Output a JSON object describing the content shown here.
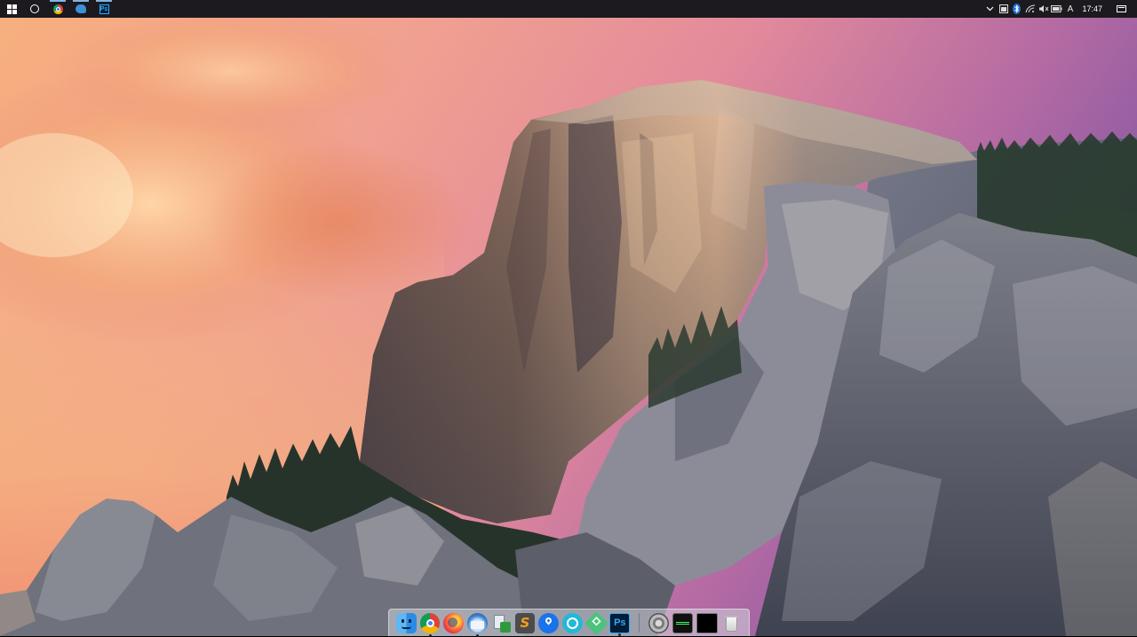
{
  "taskbar": {
    "left_items": [
      {
        "name": "start-button",
        "icon": "windows-logo-icon"
      },
      {
        "name": "cortana-search-button",
        "icon": "circle-icon"
      },
      {
        "name": "chrome-taskbar-button",
        "icon": "chrome-icon"
      },
      {
        "name": "thunderbird-taskbar-button",
        "icon": "thunderbird-icon"
      },
      {
        "name": "photoshop-taskbar-button",
        "icon": "photoshop-icon",
        "label": "Ps"
      }
    ],
    "tray_icons": [
      "chevron-up-icon",
      "taskbar-app-icon",
      "bluetooth-icon",
      "wifi-icon",
      "mute-speaker-icon",
      "battery-icon",
      "input-language-icon"
    ],
    "language_indicator": "A",
    "clock": "17:47",
    "notification_icon": "action-center-icon"
  },
  "dock": {
    "apps": [
      {
        "name": "finder",
        "icon": "finder-icon",
        "running": false
      },
      {
        "name": "chrome",
        "icon": "chrome-icon",
        "running": true
      },
      {
        "name": "firefox",
        "icon": "firefox-icon",
        "running": false
      },
      {
        "name": "thunderbird",
        "icon": "thunderbird-icon",
        "running": true
      },
      {
        "name": "preview",
        "icon": "preview-icon",
        "running": false
      },
      {
        "name": "sublime-text",
        "icon": "sublime-text-icon",
        "running": false
      },
      {
        "name": "maps",
        "icon": "maps-pin-icon",
        "running": false
      },
      {
        "name": "circle-app",
        "icon": "circle-app-icon",
        "running": false
      },
      {
        "name": "green-app",
        "icon": "green-diamond-icon",
        "running": false
      },
      {
        "name": "photoshop",
        "icon": "photoshop-icon",
        "label": "Ps",
        "running": true
      }
    ],
    "utilities": [
      {
        "name": "system-preferences",
        "icon": "gear-icon"
      },
      {
        "name": "activity-monitor",
        "icon": "activity-monitor-icon"
      },
      {
        "name": "terminal",
        "icon": "terminal-icon"
      },
      {
        "name": "trash",
        "icon": "trash-icon"
      }
    ]
  },
  "colors": {
    "taskbar_bg": "#1c1a1e",
    "dock_bg": "#d2d6dc",
    "ps_accent": "#31a8ff"
  }
}
